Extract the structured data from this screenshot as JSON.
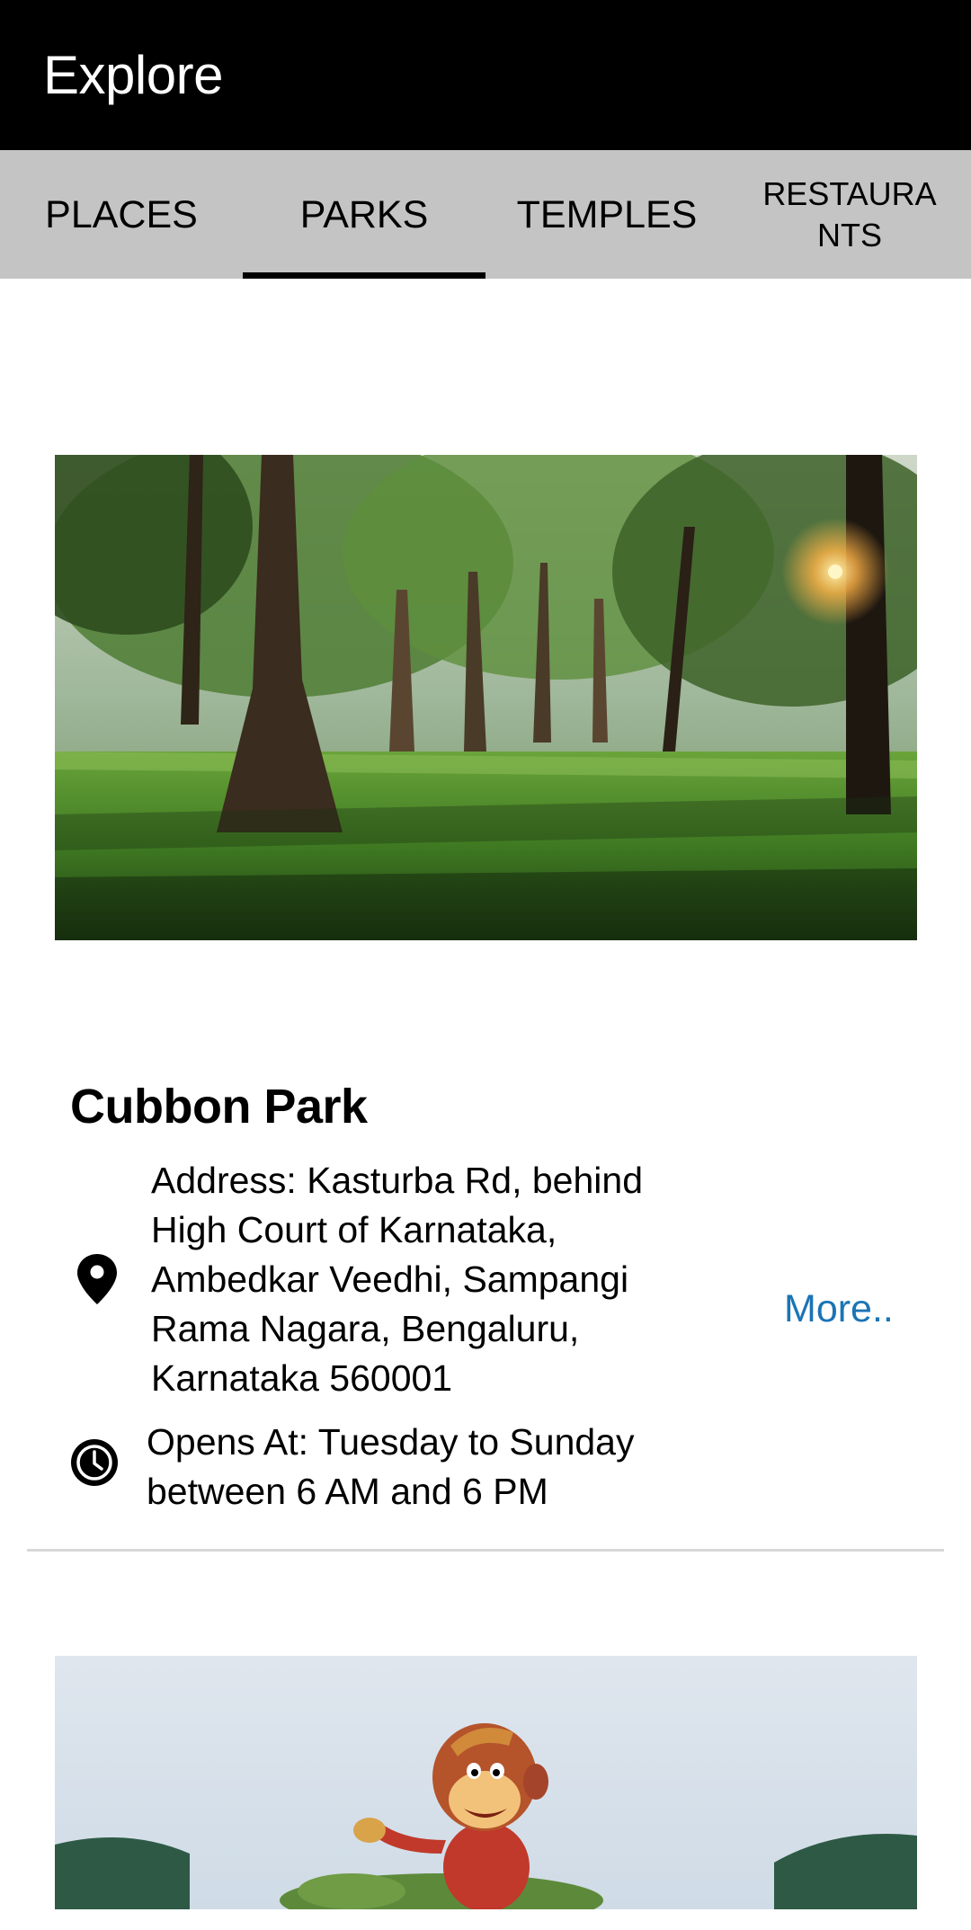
{
  "app_bar": {
    "title": "Explore",
    "background": "#000000"
  },
  "tabs": [
    {
      "label": "PLACES",
      "selected": false
    },
    {
      "label": "PARKS",
      "selected": true
    },
    {
      "label": "TEMPLES",
      "selected": false
    },
    {
      "label": "RESTAURANTS",
      "selected": false
    }
  ],
  "cards": [
    {
      "image": "cubbon-park-trees-photo",
      "title": "Cubbon Park",
      "address": "Address: Kasturba Rd, behind High Court of Karnataka, Ambedkar Veedhi, Sampangi Rama Nagara, Bengaluru, Karnataka 560001",
      "address_icon": "location-pin-icon",
      "hours": "Opens At: Tuesday to Sunday between 6 AM and 6 PM",
      "hours_icon": "clock-icon",
      "more_label": "More.."
    },
    {
      "image": "monkey-statue-park-photo"
    }
  ],
  "colors": {
    "tab_bar": "#c4c4c4",
    "link": "#1a74b5",
    "divider": "#d8d8d8"
  }
}
